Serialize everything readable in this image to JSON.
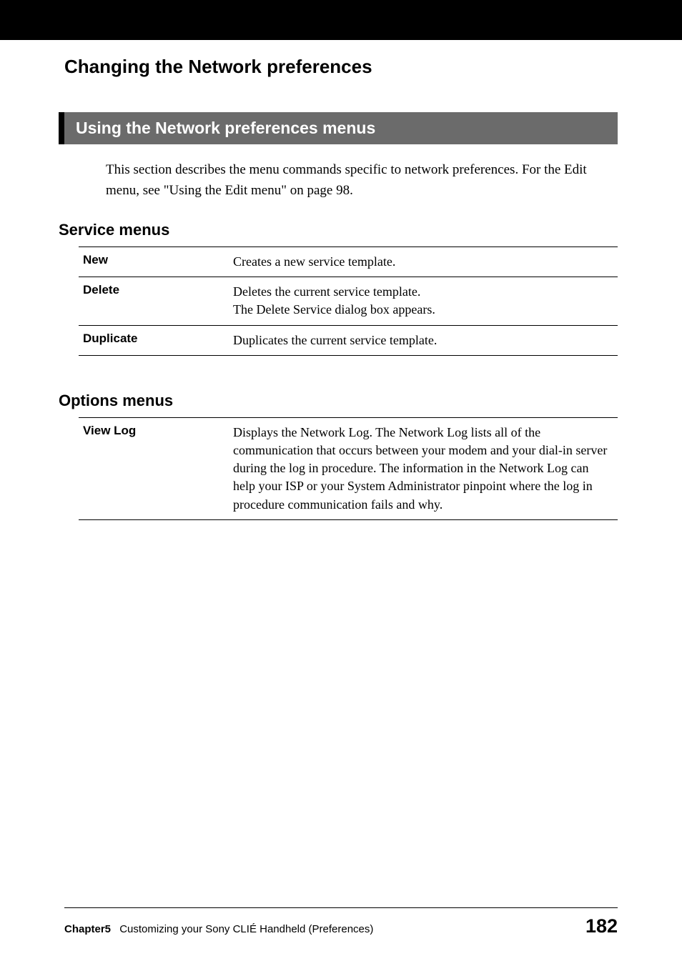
{
  "page_title": "Changing the Network preferences",
  "section_heading": "Using the Network preferences menus",
  "intro_text": "This section describes the menu commands specific to network preferences. For the Edit menu, see \"Using the Edit menu\" on page 98.",
  "service_menus": {
    "heading": "Service menus",
    "rows": [
      {
        "label": "New",
        "description": "Creates a new service template."
      },
      {
        "label": "Delete",
        "description": "Deletes the current service template.\nThe Delete Service dialog box appears."
      },
      {
        "label": "Duplicate",
        "description": "Duplicates the current service template."
      }
    ]
  },
  "options_menus": {
    "heading": "Options menus",
    "rows": [
      {
        "label": "View Log",
        "description": "Displays the Network Log. The Network Log lists all of the communication that occurs between your modem and your dial-in server during the log in procedure. The information in the Network Log can help your ISP or your System Administrator pinpoint where the log in procedure communication fails and why."
      }
    ]
  },
  "footer": {
    "chapter_label": "Chapter5",
    "chapter_title": "Customizing your Sony CLIÉ Handheld (Preferences)",
    "page_number": "182"
  }
}
